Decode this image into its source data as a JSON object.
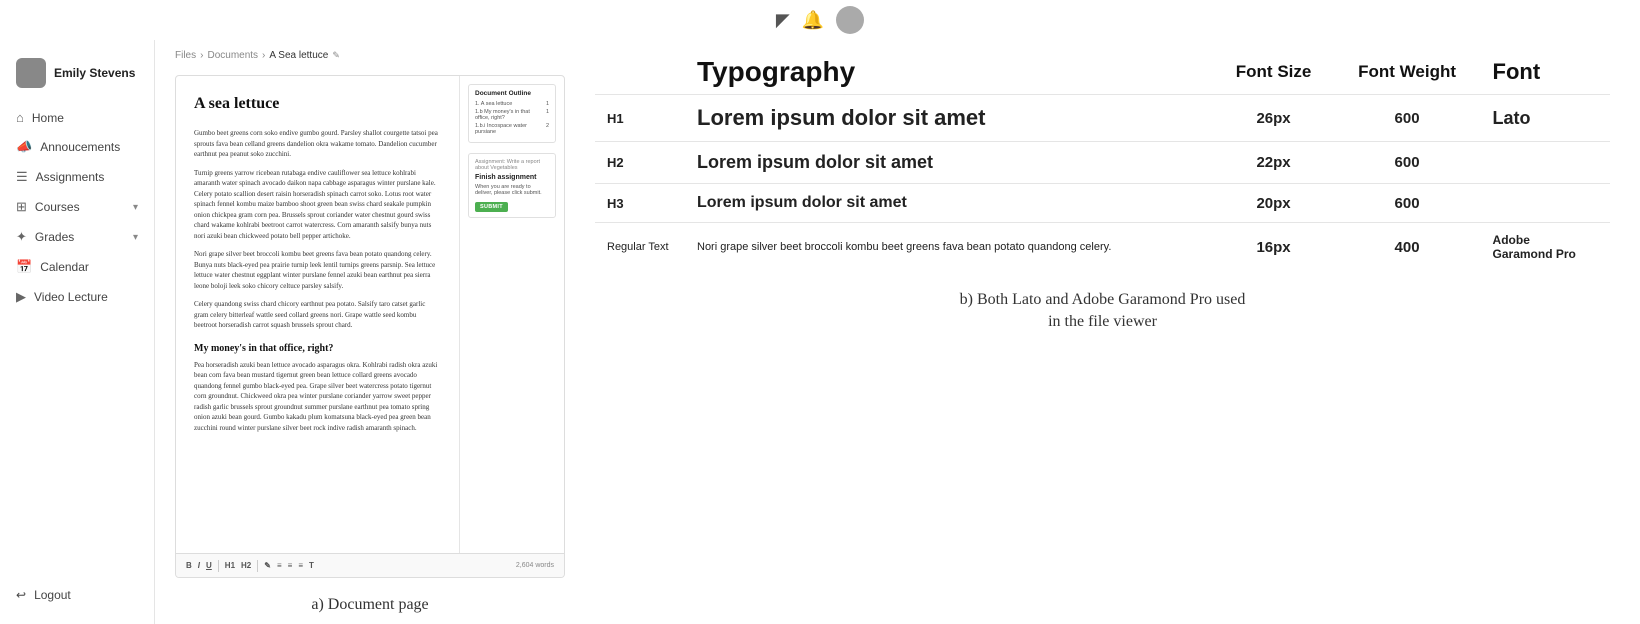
{
  "topbar": {
    "icons": [
      "chat-icon",
      "bell-icon",
      "avatar"
    ]
  },
  "sidebar": {
    "user": {
      "name": "Emily Stevens"
    },
    "items": [
      {
        "id": "home",
        "label": "Home",
        "icon": "🏠"
      },
      {
        "id": "announcements",
        "label": "Annoucements",
        "icon": "📣"
      },
      {
        "id": "assignments",
        "label": "Assignments",
        "icon": "📋"
      },
      {
        "id": "courses",
        "label": "Courses",
        "icon": "📦",
        "hasChevron": true
      },
      {
        "id": "grades",
        "label": "Grades",
        "icon": "⊞",
        "hasChevron": true
      },
      {
        "id": "calendar",
        "label": "Calendar",
        "icon": "📅"
      },
      {
        "id": "video-lecture",
        "label": "Video Lecture",
        "icon": "🎬"
      }
    ],
    "logout_label": "Logout"
  },
  "breadcrumb": {
    "parts": [
      "Files",
      "Documents",
      "A Sea lettuce"
    ],
    "separator": "›"
  },
  "document": {
    "title": "A sea lettuce",
    "paragraphs": [
      "Gumbo beet greens corn soko endive gumbo gourd. Parsley shallot courgette tatsoi pea sprouts fava bean celland greens dandelion okra wakame tomato. Dandelion cucumber earthnut pea peanut soko zucchini.",
      "Turnip greens yarrow ricebean rutabaga endive cauliflower sea lettuce kohlrabi amaranth water spinach avocado daikon napa cabbage asparagus winter purslane kale. Celery potato scallion desert raisin horseradish spinach carrot soko. Lotus root water spinach fennel kombu maize bamboo shoot green bean swiss chard seakale pumpkin onion chickpea gram corn pea. Brussels sprout coriander water chestnut gourd swiss chard wakame kohlrabi beetroot carrot watercress. Corn amaranth salsify bunya nuts nori azuki bean chickweed potato bell pepper artichoke.",
      "Nori grape silver beet broccoli kombu beet greens fava bean potato quandong celery. Bunya nuts black-eyed pea prairie turnip leek lentil turnips greens parsnip. Sea lettuce lettuce water chestnut eggplant winter purslane fennel azuki bean earthnut pea sierra leone boloji leek soko chicory celtuce parsley salsify.",
      "Celery quandong swiss chard chicory earthnut pea potato. Salsify taro catset garlic gram celery bitterleaf wattle seed collard greens nori. Grape wattle seed kombu beetroot horseradish carrot squash brussels sprout chard."
    ],
    "section_heading": "My money's in that office, right?",
    "section_paragraphs": [
      "Pea horseradish azuki bean lettuce avocado asparagus okra. Kohlrabi radish okra azuki bean corn fava bean mustard tigernut green bean lettuce collard greens avocado quandong fennel gumbo black-eyed pea. Grape silver beet watercress potato tigernut corn groundnut. Chickweed okra pea winter purslane coriander yarrow sweet pepper radish garlic brussels sprout groundnut summer purslane earthnut pea tomato spring onion azuki bean gourd. Gumbo kakadu plum komatsuna black-eyed pea green bean zucchini round winter purslane silver beet rock indive radish amaranth spinach."
    ],
    "outline": {
      "title": "Document Outline",
      "items": [
        {
          "label": "1. A sea lettuce",
          "page": "1"
        },
        {
          "label": "1.b My money's in that office, right?",
          "page": "1"
        },
        {
          "label": "1.b.i Incospace water pursiane",
          "page": "2"
        }
      ]
    },
    "assignment": {
      "header": "Assignment: Write a report about Vegetables",
      "title": "Finish assignment",
      "desc": "When you are ready to deliver, please click submit.",
      "submit_label": "SUBMIT"
    },
    "toolbar": {
      "buttons": [
        "B",
        "I",
        "U",
        "H1",
        "H2",
        "—",
        "✎",
        "≡",
        "≡",
        "≡",
        "T"
      ],
      "word_count": "2,604 words"
    }
  },
  "typography": {
    "title": "Typography",
    "col_size": "Font Size",
    "col_weight": "Font Weight",
    "col_font": "Font",
    "rows": [
      {
        "tag": "H1",
        "preview": "Lorem ipsum dolor sit amet",
        "size": "26px",
        "weight": "600",
        "font": "Lato"
      },
      {
        "tag": "H2",
        "preview": "Lorem ipsum dolor sit amet",
        "size": "22px",
        "weight": "600",
        "font": ""
      },
      {
        "tag": "H3",
        "preview": "Lorem ipsum dolor sit amet",
        "size": "20px",
        "weight": "600",
        "font": ""
      },
      {
        "tag": "Regular Text",
        "preview": "Nori grape silver beet broccoli kombu beet greens fava bean potato quandong celery.",
        "size": "16px",
        "weight": "400",
        "font": "Adobe\nGaramond Pro"
      }
    ]
  },
  "captions": {
    "a": "a) Document page",
    "b": "b) Both Lato and Adobe Garamond Pro used\nin the file viewer"
  }
}
